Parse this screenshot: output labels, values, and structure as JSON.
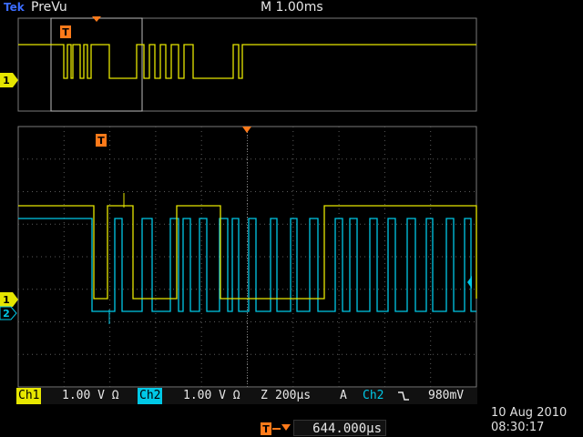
{
  "header": {
    "brand": "Tek",
    "acquisition_state": "PreVu",
    "timebase": "M 1.00ms"
  },
  "markers": {
    "trigger_glyph": "T",
    "ch1_glyph": "1",
    "ch2_glyph": "2"
  },
  "status_bar": {
    "ch1_label": "Ch1",
    "ch1_scale": "1.00 V Ω",
    "ch2_label": "Ch2",
    "ch2_scale": "1.00 V Ω",
    "zoom_label": "Z",
    "zoom_scale": "200µs",
    "trigger_label": "A",
    "trigger_source": "Ch2",
    "trigger_slope_icon": "falling-edge-icon",
    "trigger_level": "980mV"
  },
  "trigger_position": {
    "value": "644.000µs"
  },
  "datetime": {
    "date": "10 Aug 2010",
    "time": "08:30:17"
  },
  "colors": {
    "ch1": "#e6e600",
    "ch2": "#00c8e6",
    "trigger": "#ff7a1a",
    "grid": "#6a6a6a"
  }
}
